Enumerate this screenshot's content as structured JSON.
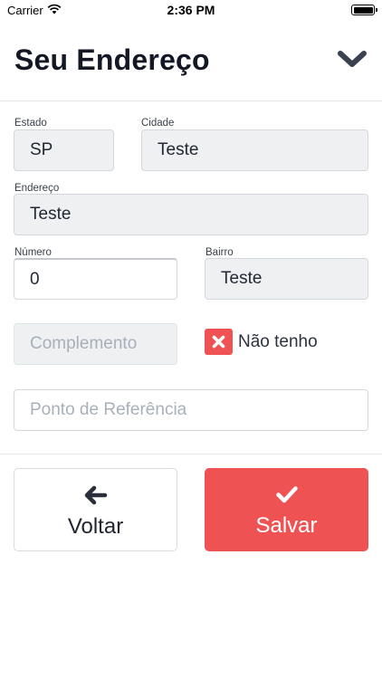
{
  "status_bar": {
    "carrier": "Carrier",
    "time": "2:36 PM"
  },
  "header": {
    "title": "Seu Endereço"
  },
  "form": {
    "estado": {
      "label": "Estado",
      "value": "SP"
    },
    "cidade": {
      "label": "Cidade",
      "value": "Teste"
    },
    "endereco": {
      "label": "Endereço",
      "value": "Teste"
    },
    "numero": {
      "label": "Número",
      "value": "0"
    },
    "bairro": {
      "label": "Bairro",
      "value": "Teste"
    },
    "complemento": {
      "placeholder": "Complemento",
      "disabled": true
    },
    "nao_tenho": {
      "label": "Não tenho",
      "checked": true
    },
    "ponto_referencia": {
      "placeholder": "Ponto de Referência"
    }
  },
  "actions": {
    "back_label": "Voltar",
    "save_label": "Salvar"
  },
  "colors": {
    "accent": "#ef5253",
    "field_disabled_bg": "#eef0f2",
    "text": "#1f2430"
  },
  "icons": {
    "collapse": "chevron-down-icon",
    "back": "arrow-left-icon",
    "save": "check-icon",
    "checkbox": "x-mark-icon"
  }
}
